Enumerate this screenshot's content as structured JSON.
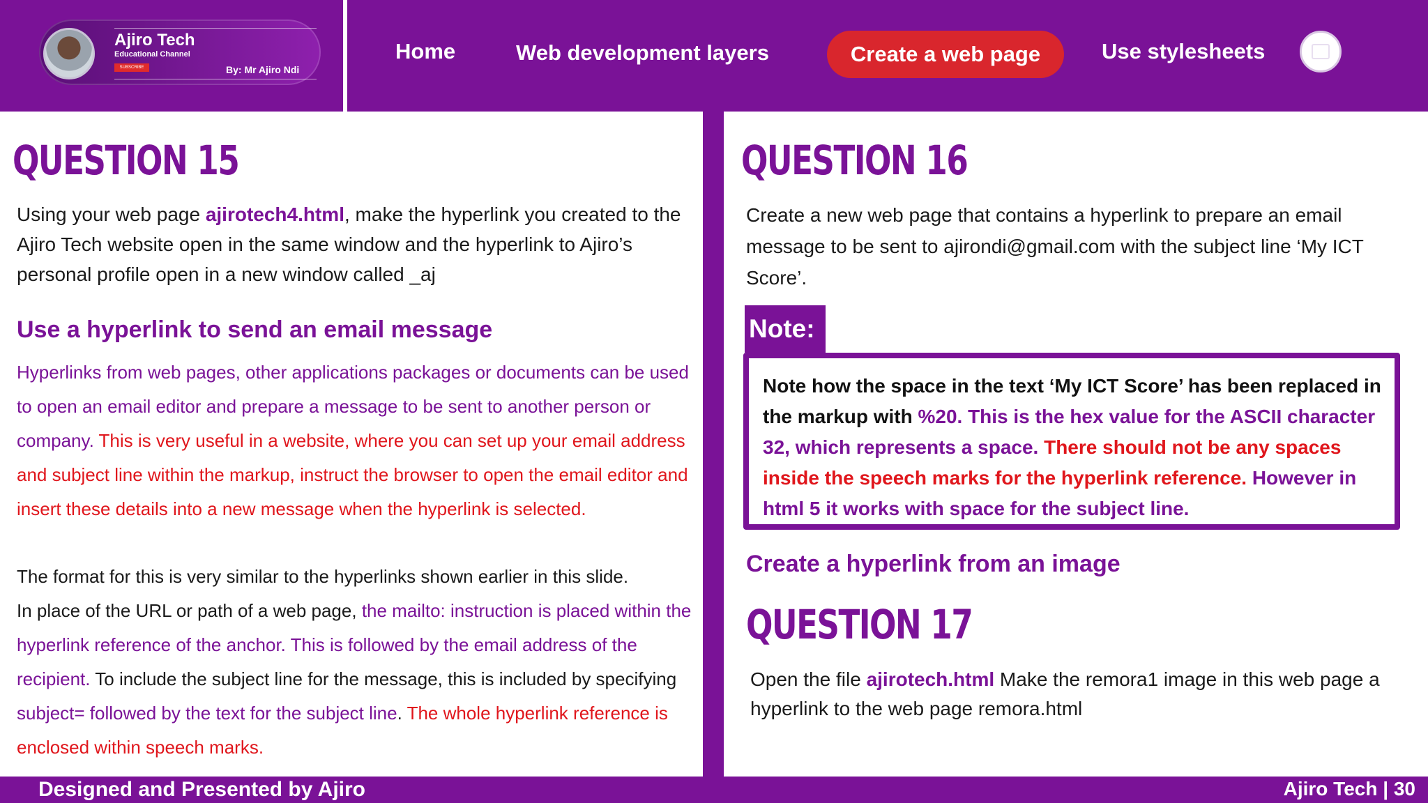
{
  "header": {
    "logo": {
      "title": "Ajiro Tech",
      "subtitle": "Educational Channel",
      "subscribe": "SUBSCRIBE",
      "author": "By: Mr Ajiro Ndi"
    },
    "nav": {
      "home": "Home",
      "layers": "Web development layers",
      "create": "Create a web page",
      "styles": "Use stylesheets"
    }
  },
  "left": {
    "q15_title": "QUESTION 15",
    "q15_text": {
      "p1": "Using your web page ",
      "file": "ajirotech4.html",
      "p2": ", make the hyperlink you created to the Ajiro Tech website open in the same window and the hyperlink to Ajiro’s personal profile open in a new window called _aj"
    },
    "email_heading": "Use a hyperlink to send an email message",
    "email_para": {
      "purple": "Hyperlinks from web pages, other applications packages or documents can be used to open an email editor and prepare a message to be sent to another person or company. ",
      "red": "This is very useful in a website, where you can set up your email address and subject line within the markup, instruct the browser to open the email editor and insert these details into a new message when the hyperlink is selected."
    },
    "format_para": {
      "line1": "The format for this is very similar to the hyperlinks shown earlier in this slide.",
      "p2": "In place of the URL or path of a web page, ",
      "purple1": "the mailto: instruction is placed within the hyperlink reference of the anchor. This is followed by the email address of the recipient.",
      "p3": " To include the subject line for the message, this is included by specifying ",
      "purple2": "subject= followed by the text for the subject line",
      "p4": ". ",
      "red": "The whole hyperlink reference is enclosed within speech marks."
    }
  },
  "right": {
    "q16_title": "QUESTION 16",
    "q16_text": "Create a new web page that contains a hyperlink to prepare an email message to be sent to ajirondi@gmail.com with the subject line ‘My ICT Score’.",
    "note_label": "Note:",
    "note": {
      "black": "Note how the space in the text ‘My ICT Score’ has been replaced in the markup with ",
      "purple1": "%20. This is the hex value for the ASCII character 32, which represents a space. ",
      "red": "There should not be any spaces inside the speech marks for the hyperlink reference. ",
      "purple2": "However in html 5 it works with space for the subject line."
    },
    "image_heading": "Create a hyperlink from an image",
    "q17_title": "QUESTION 17",
    "q17_text": {
      "p1": "Open the file ",
      "file": "ajirotech.html",
      "p2": " Make the remora1 image in this web page a hyperlink to the web page remora.html"
    }
  },
  "footer": {
    "left": "Designed and Presented by Ajiro",
    "right": "Ajiro Tech | 30"
  }
}
